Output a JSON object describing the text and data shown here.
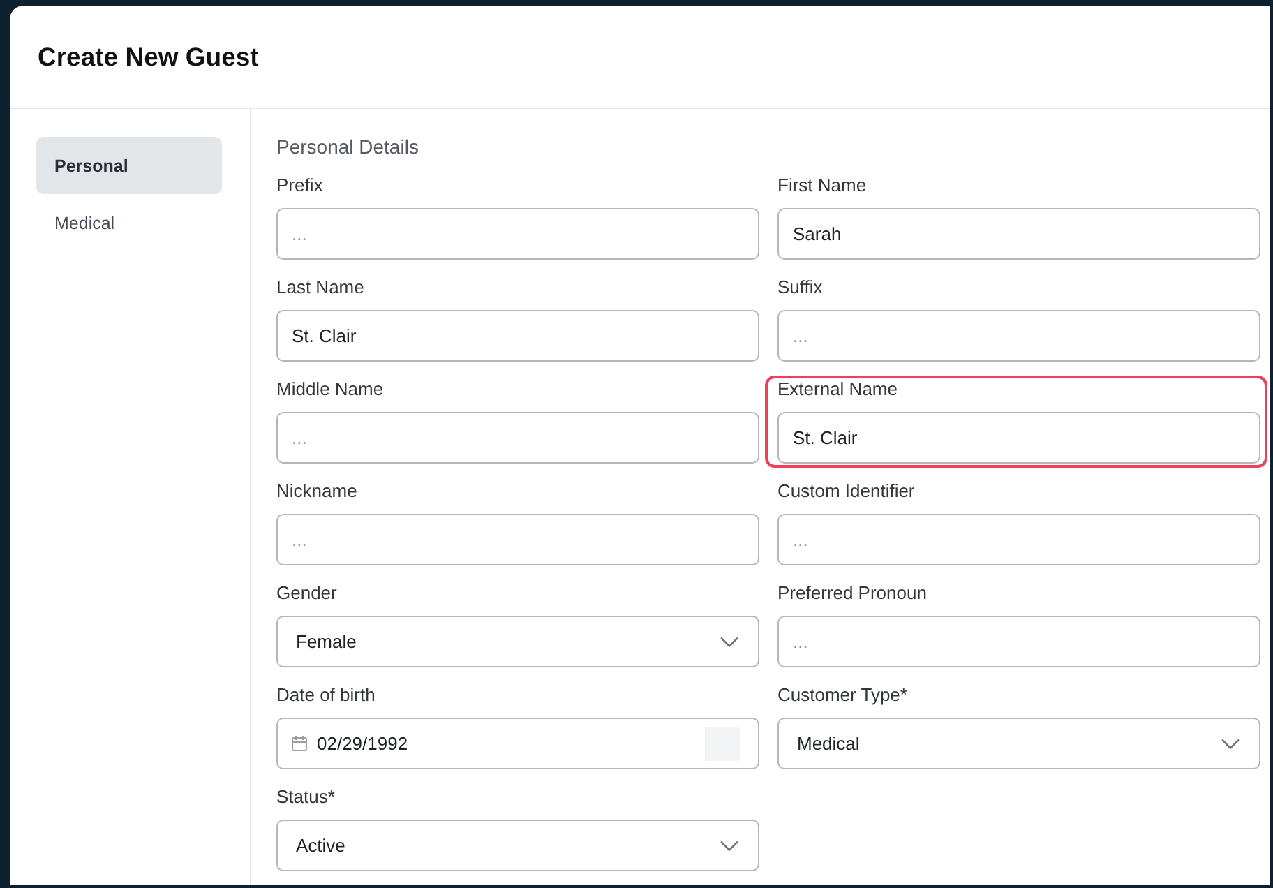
{
  "window": {
    "title": "Create New Guest"
  },
  "sidebar": {
    "items": [
      {
        "label": "Personal",
        "selected": true
      },
      {
        "label": "Medical",
        "selected": false
      }
    ]
  },
  "section": {
    "title": "Personal Details"
  },
  "fields": [
    {
      "kind": "text",
      "label": "Prefix",
      "placeholder": "...",
      "highlighted": false
    },
    {
      "kind": "text",
      "label": "First Name",
      "value": "Sarah",
      "highlighted": false
    },
    {
      "kind": "text",
      "label": "Last Name",
      "value": "St. Clair",
      "highlighted": false
    },
    {
      "kind": "text",
      "label": "Suffix",
      "placeholder": "...",
      "highlighted": false
    },
    {
      "kind": "text",
      "label": "Middle Name",
      "placeholder": "...",
      "highlighted": false
    },
    {
      "kind": "text",
      "label": "External Name",
      "value": "St. Clair",
      "highlighted": true
    },
    {
      "kind": "text",
      "label": "Nickname",
      "placeholder": "...",
      "highlighted": false
    },
    {
      "kind": "text",
      "label": "Custom Identifier",
      "placeholder": "...",
      "highlighted": false
    },
    {
      "kind": "select",
      "label": "Gender",
      "value": "Female",
      "highlighted": false
    },
    {
      "kind": "text",
      "label": "Preferred Pronoun",
      "placeholder": "...",
      "highlighted": false
    },
    {
      "kind": "date",
      "label": "Date of birth",
      "value": "02/29/1992",
      "highlighted": false
    },
    {
      "kind": "select",
      "label": "Customer Type*",
      "value": "Medical",
      "highlighted": false
    },
    {
      "kind": "select",
      "label": "Status*",
      "value": "Active",
      "highlighted": false
    }
  ]
}
